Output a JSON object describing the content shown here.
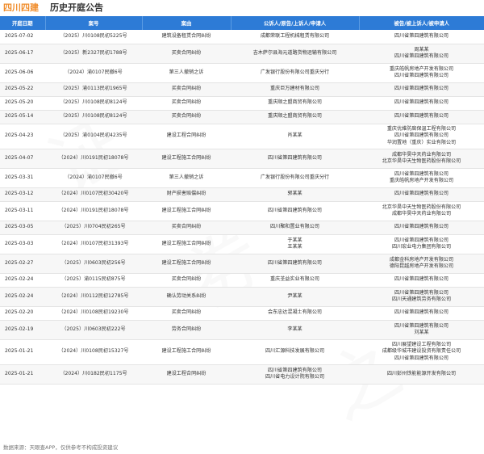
{
  "header": {
    "company": "四川四建",
    "title": "历史开庭公告"
  },
  "table": {
    "columns": [
      "开庭日期",
      "案号",
      "案由",
      "公诉人/原告/上诉人/申请人",
      "被告/被上诉人/被申请人"
    ],
    "rows": [
      {
        "date": "2025-07-02",
        "case_no": "（2025）川0108民初5225号",
        "cause": "建筑设备租赁合同纠纷",
        "plaintiffs": [
          "成都荣联工程机械租赁有限公司"
        ],
        "defendants": [
          "四川省第四建筑有限公司"
        ]
      },
      {
        "date": "2025-06-17",
        "case_no": "（2025）新2327民初1788号",
        "cause": "买卖合同纠纷",
        "plaintiffs": [
          "吉木萨尔县海元道路货物运输有限公司"
        ],
        "defendants": [
          "周某某",
          "四川省第四建筑有限公司"
        ]
      },
      {
        "date": "2025-06-06",
        "case_no": "（2024）渝0107民撤6号",
        "cause": "第三人撤销之诉",
        "plaintiffs": [
          "广发银行股份有限公司重庆分行"
        ],
        "defendants": [
          "重庆皓帆房地产开发有限公司",
          "四川省第四建筑有限公司"
        ]
      },
      {
        "date": "2025-05-22",
        "case_no": "（2025）渝0113民初1965号",
        "cause": "买卖合同纠纷",
        "plaintiffs": [
          "重庆巨万建材有限公司"
        ],
        "defendants": [
          "四川省第四建筑有限公司"
        ]
      },
      {
        "date": "2025-05-20",
        "case_no": "（2025）川0108民初8124号",
        "cause": "买卖合同纠纷",
        "plaintiffs": [
          "重庆顺之盟商贸有限公司"
        ],
        "defendants": [
          "四川省第四建筑有限公司"
        ]
      },
      {
        "date": "2025-05-14",
        "case_no": "（2025）川0108民初8124号",
        "cause": "买卖合同纠纷",
        "plaintiffs": [
          "重庆顺之盟商贸有限公司"
        ],
        "defendants": [
          "四川省第四建筑有限公司"
        ]
      },
      {
        "date": "2025-04-23",
        "case_no": "（2025）渝0104民初4235号",
        "cause": "建设工程合同纠纷",
        "plaintiffs": [
          "肖某某"
        ],
        "defendants": [
          "重庆优維防腐保温工程有限公司",
          "四川省第四建筑有限公司",
          "华润置地（重庆）实业有限公司"
        ]
      },
      {
        "date": "2025-04-07",
        "case_no": "（2024）川0191民初18078号",
        "cause": "建设工程施工合同纠纷",
        "plaintiffs": [
          "四川省第四建筑有限公司"
        ],
        "defendants": [
          "成都华昊中天药业有限公司",
          "北京华昊中天生物医药股份有限公司"
        ]
      },
      {
        "date": "2025-03-31",
        "case_no": "（2024）渝0107民撤6号",
        "cause": "第三人撤销之诉",
        "plaintiffs": [
          "广发银行股份有限公司重庆分行"
        ],
        "defendants": [
          "四川省第四建筑有限公司",
          "重庆皓帆房地产开发有限公司"
        ]
      },
      {
        "date": "2025-03-12",
        "case_no": "（2024）川0107民初30420号",
        "cause": "财产损害赔偿纠纷",
        "plaintiffs": [
          "郭某某"
        ],
        "defendants": [
          "四川省第四建筑有限公司"
        ]
      },
      {
        "date": "2025-03-11",
        "case_no": "（2024）川0191民初18078号",
        "cause": "建设工程施工合同纠纷",
        "plaintiffs": [
          "四川省第四建筑有限公司"
        ],
        "defendants": [
          "北京华昊中天生物医药股份有限公司",
          "成都华昊中天药业有限公司"
        ]
      },
      {
        "date": "2025-03-05",
        "case_no": "（2025）川0704民初265号",
        "cause": "买卖合同纠纷",
        "plaintiffs": [
          "四川聚和置业有限公司"
        ],
        "defendants": [
          "四川省第四建筑有限公司"
        ]
      },
      {
        "date": "2025-03-03",
        "case_no": "（2024）川0107民初31393号",
        "cause": "建设工程施工合同纠纷",
        "plaintiffs": [
          "于某某",
          "王某某"
        ],
        "defendants": [
          "四川省第四建筑有限公司",
          "四川宏业电力集团有限公司"
        ]
      },
      {
        "date": "2025-02-27",
        "case_no": "（2025）川0603民初256号",
        "cause": "建设工程施工合同纠纷",
        "plaintiffs": [
          "四川省第四建筑有限公司"
        ],
        "defendants": [
          "成都金科房地产开发有限公司",
          "德阳昆越房地产开发有限公司"
        ]
      },
      {
        "date": "2025-02-24",
        "case_no": "（2025）渝0115民初875号",
        "cause": "买卖合同纠纷",
        "plaintiffs": [
          "重庆荃益实业有限公司"
        ],
        "defendants": [
          "四川省第四建筑有限公司"
        ]
      },
      {
        "date": "2025-02-24",
        "case_no": "（2024）川0112民初12785号",
        "cause": "确认劳动关系纠纷",
        "plaintiffs": [
          "尹某某"
        ],
        "defendants": [
          "四川省第四建筑有限公司",
          "四川天通建筑劳务有限公司"
        ]
      },
      {
        "date": "2025-02-20",
        "case_no": "（2024）川0108民初19230号",
        "cause": "买卖合同纠纷",
        "plaintiffs": [
          "会东忠达混凝土有限公司"
        ],
        "defendants": [
          "四川省第四建筑有限公司"
        ]
      },
      {
        "date": "2025-02-19",
        "case_no": "（2025）川0603民初222号",
        "cause": "劳务合同纠纷",
        "plaintiffs": [
          "李某某"
        ],
        "defendants": [
          "四川省第四建筑有限公司",
          "刘某某"
        ]
      },
      {
        "date": "2025-01-21",
        "case_no": "（2024）川0108民初15327号",
        "cause": "建设工程施工合同纠纷",
        "plaintiffs": [
          "四川汇源科技发展有限公司"
        ],
        "defendants": [
          "四川展望建设工程有限公司",
          "成都级华城市建设投资有限责任公司",
          "四川省第四建筑有限公司"
        ]
      },
      {
        "date": "2025-01-21",
        "case_no": "（2024）川0182民初1175号",
        "cause": "建设工程合同纠纷",
        "plaintiffs": [
          "四川省第四建筑有限公司",
          "四川省电力设计院有限公司"
        ],
        "defendants": [
          "四川彭州铁能能源开发有限公司"
        ]
      }
    ]
  },
  "footer": {
    "source": "数据来源：天眼查APP，仅供参考不构成投资建议"
  }
}
